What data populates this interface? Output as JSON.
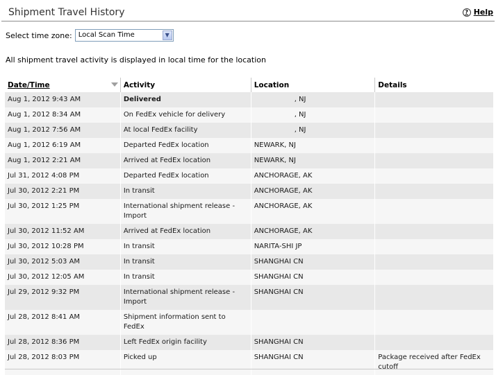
{
  "header": {
    "title": "Shipment Travel History",
    "help_label": "Help",
    "help_icon": "?"
  },
  "timezone": {
    "label": "Select time zone:",
    "selected": "Local Scan Time"
  },
  "notice": "All shipment travel activity is displayed in local time for the location",
  "table": {
    "columns": [
      "Date/Time",
      "Activity",
      "Location",
      "Details"
    ],
    "rows": [
      {
        "date": "Aug 1, 2012 9:43 AM",
        "activity": "Delivered",
        "location": ", NJ",
        "details": ""
      },
      {
        "date": "Aug 1, 2012 8:34 AM",
        "activity": "On FedEx vehicle for delivery",
        "location": ", NJ",
        "details": ""
      },
      {
        "date": "Aug 1, 2012 7:56 AM",
        "activity": "At local FedEx facility",
        "location": ", NJ",
        "details": ""
      },
      {
        "date": "Aug 1, 2012 6:19 AM",
        "activity": "Departed FedEx location",
        "location": "NEWARK, NJ",
        "details": ""
      },
      {
        "date": "Aug 1, 2012 2:21 AM",
        "activity": "Arrived at FedEx location",
        "location": "NEWARK, NJ",
        "details": ""
      },
      {
        "date": "Jul 31, 2012 4:08 PM",
        "activity": "Departed FedEx location",
        "location": "ANCHORAGE, AK",
        "details": ""
      },
      {
        "date": "Jul 30, 2012 2:21 PM",
        "activity": "In transit",
        "location": "ANCHORAGE, AK",
        "details": ""
      },
      {
        "date": "Jul 30, 2012 1:25 PM",
        "activity": "International shipment release - Import",
        "location": "ANCHORAGE, AK",
        "details": ""
      },
      {
        "date": "Jul 30, 2012 11:52 AM",
        "activity": "Arrived at FedEx location",
        "location": "ANCHORAGE, AK",
        "details": ""
      },
      {
        "date": "Jul 30, 2012 10:28 PM",
        "activity": "In transit",
        "location": "NARITA-SHI JP",
        "details": ""
      },
      {
        "date": "Jul 30, 2012 5:03 AM",
        "activity": "In transit",
        "location": "SHANGHAI CN",
        "details": ""
      },
      {
        "date": "Jul 30, 2012 12:05 AM",
        "activity": "In transit",
        "location": "SHANGHAI CN",
        "details": ""
      },
      {
        "date": "Jul 29, 2012 9:32 PM",
        "activity": "International shipment release - Import",
        "location": "SHANGHAI CN",
        "details": ""
      },
      {
        "date": "Jul 28, 2012 8:41 AM",
        "activity": "Shipment information sent to FedEx",
        "location": "",
        "details": ""
      },
      {
        "date": "Jul 28, 2012 8:36 PM",
        "activity": "Left FedEx origin facility",
        "location": "SHANGHAI CN",
        "details": ""
      },
      {
        "date": "Jul 28, 2012 8:03 PM",
        "activity": "Picked up",
        "location": "SHANGHAI CN",
        "details": "Package received after FedEx cutoff"
      }
    ]
  }
}
